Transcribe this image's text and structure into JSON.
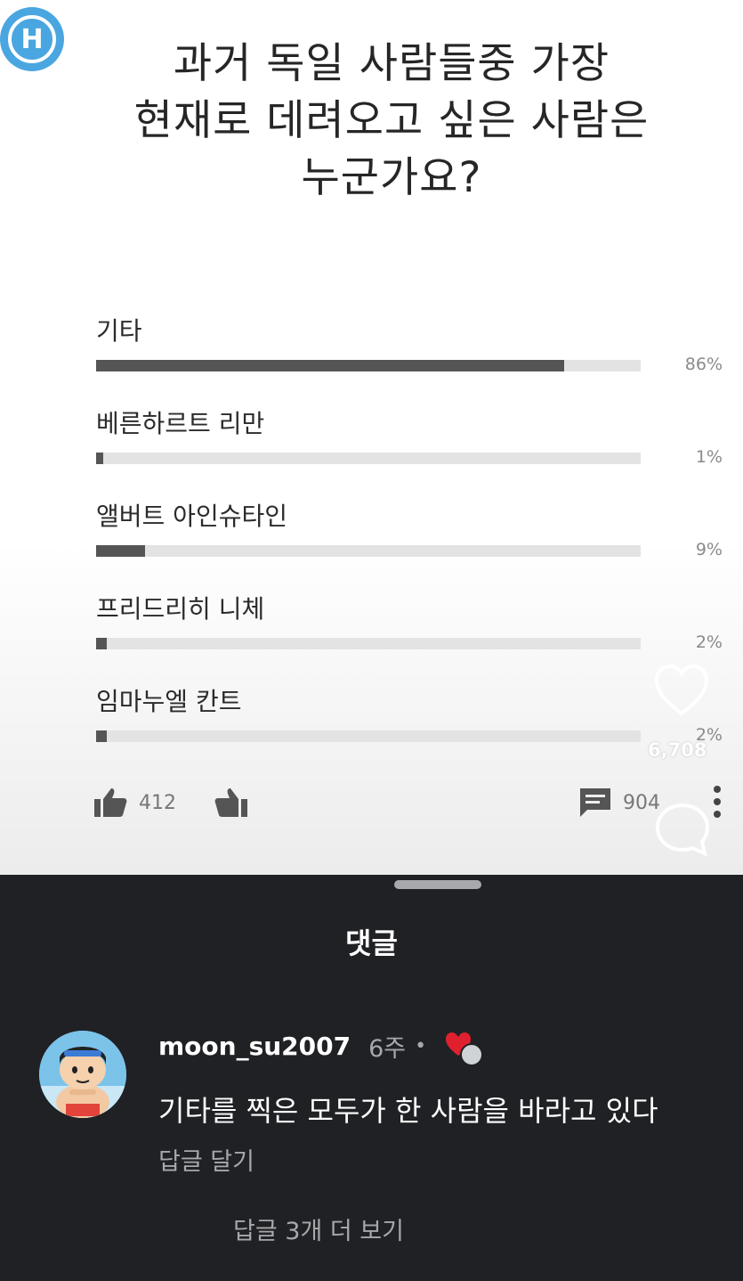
{
  "logo": {
    "letter": "H"
  },
  "poll": {
    "question": "과거 독일 사람들중 가장\n현재로 데려오고 싶은 사람은\n누군가요?",
    "options": [
      {
        "label": "기타",
        "percent_label": "86%",
        "value": 86
      },
      {
        "label": "베른하르트 리만",
        "percent_label": "1%",
        "value": 1
      },
      {
        "label": "앨버트 아인슈타인",
        "percent_label": "9%",
        "value": 9
      },
      {
        "label": "프리드리히 니체",
        "percent_label": "2%",
        "value": 2
      },
      {
        "label": "임마누엘 칸트",
        "percent_label": "2%",
        "value": 2
      }
    ],
    "likes": "412",
    "comments": "904"
  },
  "overlay": {
    "like_count": "6,708"
  },
  "comments_sheet": {
    "title": "댓글",
    "comment": {
      "username": "moon_su2007",
      "time": "6주",
      "separator": "•",
      "text": "기타를 찍은 모두가 한 사람을 바라고 있다",
      "reply_label": "답글 달기",
      "more_replies_label": "답글 3개 더 보기"
    }
  },
  "colors": {
    "bar_fill": "#555555",
    "bar_track": "#e3e3e3",
    "sheet_bg": "#202125",
    "heart_red": "#e0202e",
    "logo_blue": "#4aa6e0"
  }
}
